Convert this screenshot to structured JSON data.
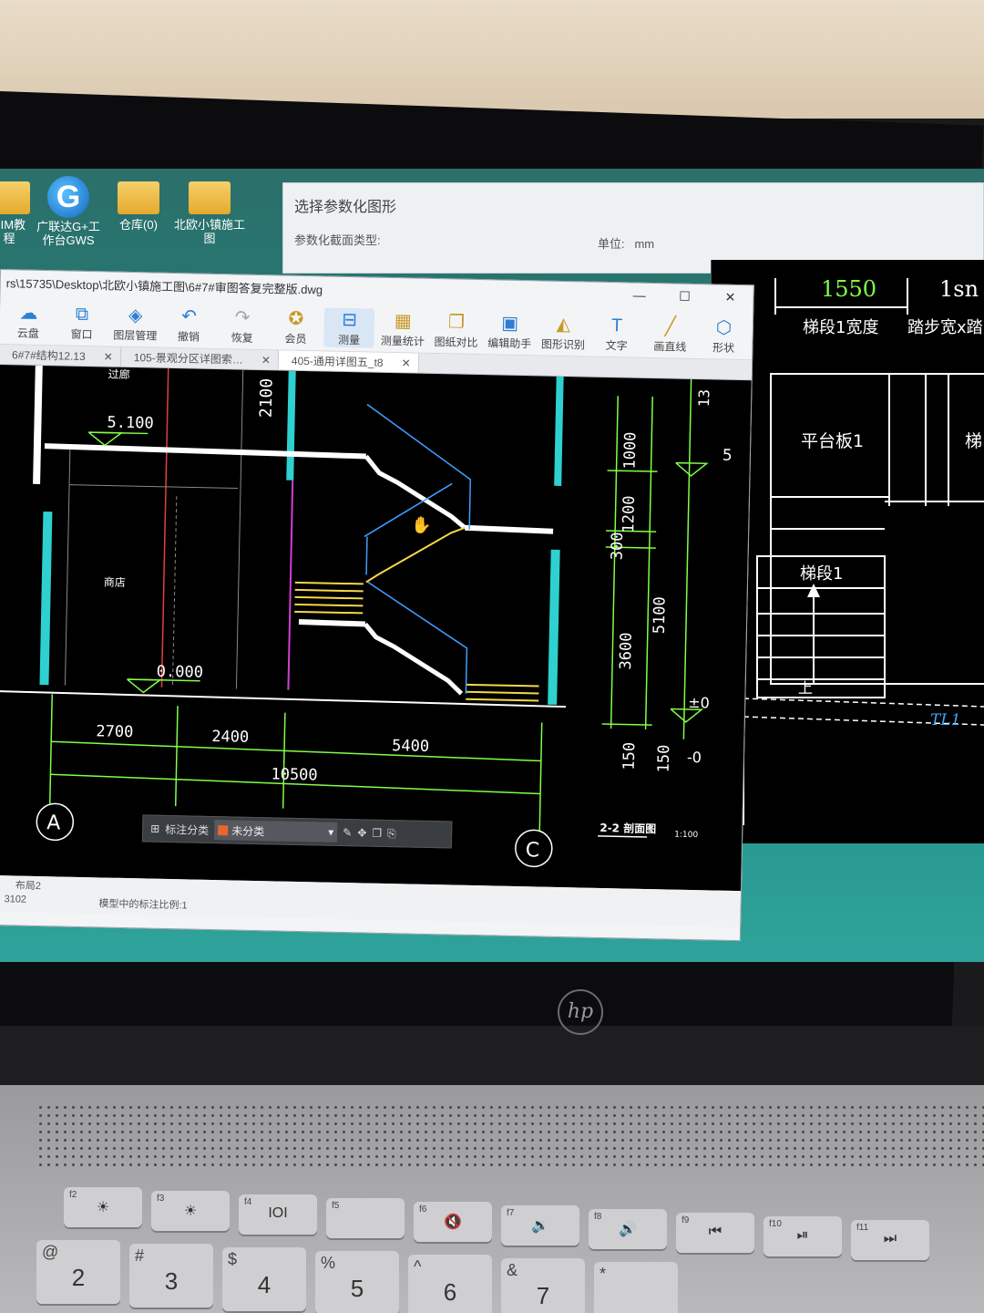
{
  "desktop": {
    "icons": [
      {
        "label": "BIM教\n程"
      },
      {
        "label": "广联达G+工\n作台GWS"
      },
      {
        "label": "仓库(0)"
      },
      {
        "label": "北欧小镇施工\n图"
      }
    ]
  },
  "param_dialog": {
    "title": "选择参数化图形",
    "section_label": "参数化截面类型:",
    "unit_label": "单位:",
    "unit_value": "mm"
  },
  "window": {
    "path": "rs\\15735\\Desktop\\北欧小镇施工图\\6#7#审图答复完整版.dwg",
    "controls": {
      "minimize": "—",
      "maximize": "☐",
      "close": "✕"
    }
  },
  "toolbar": [
    {
      "label": "云盘",
      "icon": "cloud-icon"
    },
    {
      "label": "窗口",
      "icon": "window-icon"
    },
    {
      "label": "图层管理",
      "icon": "layers-icon"
    },
    {
      "label": "撤销",
      "icon": "undo-icon"
    },
    {
      "label": "恢复",
      "icon": "redo-icon"
    },
    {
      "label": "会员",
      "icon": "vip-icon"
    },
    {
      "label": "测量",
      "icon": "measure-icon"
    },
    {
      "label": "测量统计",
      "icon": "measure-stats-icon"
    },
    {
      "label": "图纸对比",
      "icon": "compare-icon"
    },
    {
      "label": "编辑助手",
      "icon": "edit-assistant-icon"
    },
    {
      "label": "图形识别",
      "icon": "shape-recognition-icon"
    },
    {
      "label": "文字",
      "icon": "text-icon"
    },
    {
      "label": "画直线",
      "icon": "line-icon"
    },
    {
      "label": "形状",
      "icon": "shape-icon"
    }
  ],
  "tabs": [
    {
      "label": "6#7#结构12.13"
    },
    {
      "label": "105-景观分区详图索…"
    },
    {
      "label": "405-通用详图五_t8"
    }
  ],
  "drawing": {
    "corridor_label": "过廊",
    "shop_label": "商店",
    "elev_top": "5.100",
    "elev_ground": "0.000",
    "dim_2100": "2100",
    "dim_1000": "1000",
    "dim_1200": "1200",
    "dim_300": "300",
    "dim_5100": "5100",
    "dim_3600": "3600",
    "dim_150a": "150",
    "dim_150b": "150",
    "dim_13": "13",
    "dim_5": "5",
    "elev_pm0": "±0",
    "elev_m0": "-0",
    "dim_2700": "2700",
    "dim_2400": "2400",
    "dim_5400": "5400",
    "dim_10500": "10500",
    "axis_a": "A",
    "axis_c": "C",
    "section_title": "2-2 剖面图",
    "section_scale": "1:100"
  },
  "annot_bar": {
    "label": "标注分类",
    "selected": "未分类"
  },
  "status": {
    "layout_tab": "布局2",
    "coord": "3102",
    "scale_text": "模型中的标注比例:1"
  },
  "right_panel": {
    "dim_1550": "1550",
    "dim_1sn": "1sn",
    "width_label": "梯段1宽度",
    "step_label": "踏步宽x踏",
    "slab_label": "平台板1",
    "stair_label": "梯",
    "flight_label": "梯段1",
    "up_label": "上",
    "beam_label": "TL1"
  },
  "laptop": {
    "brand": "hp",
    "fkeys": [
      {
        "f": "f2",
        "glyph": "☀"
      },
      {
        "f": "f3",
        "glyph": "☀"
      },
      {
        "f": "f4",
        "glyph": "IOI"
      },
      {
        "f": "f5",
        "glyph": ""
      },
      {
        "f": "f6",
        "glyph": "🔇"
      },
      {
        "f": "f7",
        "glyph": "🔉"
      },
      {
        "f": "f8",
        "glyph": "🔊"
      },
      {
        "f": "f9",
        "glyph": "⏮"
      },
      {
        "f": "f10",
        "glyph": "⏯"
      },
      {
        "f": "f11",
        "glyph": "⏭"
      }
    ],
    "numkeys": [
      {
        "top": "@",
        "main": "2"
      },
      {
        "top": "#",
        "main": "3"
      },
      {
        "top": "$",
        "main": "4"
      },
      {
        "top": "%",
        "main": "5"
      },
      {
        "top": "^",
        "main": "6"
      },
      {
        "top": "&",
        "main": "7"
      },
      {
        "top": "*",
        "main": ""
      }
    ]
  }
}
